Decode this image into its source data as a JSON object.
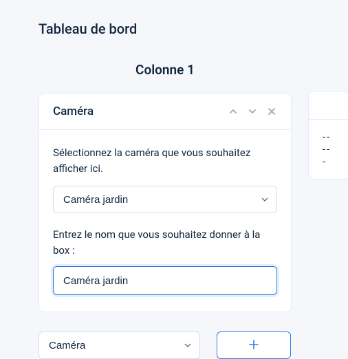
{
  "page_title": "Tableau de bord",
  "columns": [
    {
      "title": "Colonne 1",
      "card": {
        "title": "Caméra",
        "help": "Sélectionnez la caméra que vous souhaitez afficher ici.",
        "camera_select": {
          "value": "Caméra jardin",
          "options": [
            "Caméra jardin"
          ]
        },
        "name_label": "Entrez le nom que vous souhaitez donner à la box :",
        "name_input_value": "Caméra jardin"
      },
      "add_select": {
        "value": "Caméra",
        "options": [
          "Caméra"
        ]
      }
    }
  ],
  "col2_placeholder": "-----",
  "colors": {
    "accent": "#2c7be5"
  }
}
